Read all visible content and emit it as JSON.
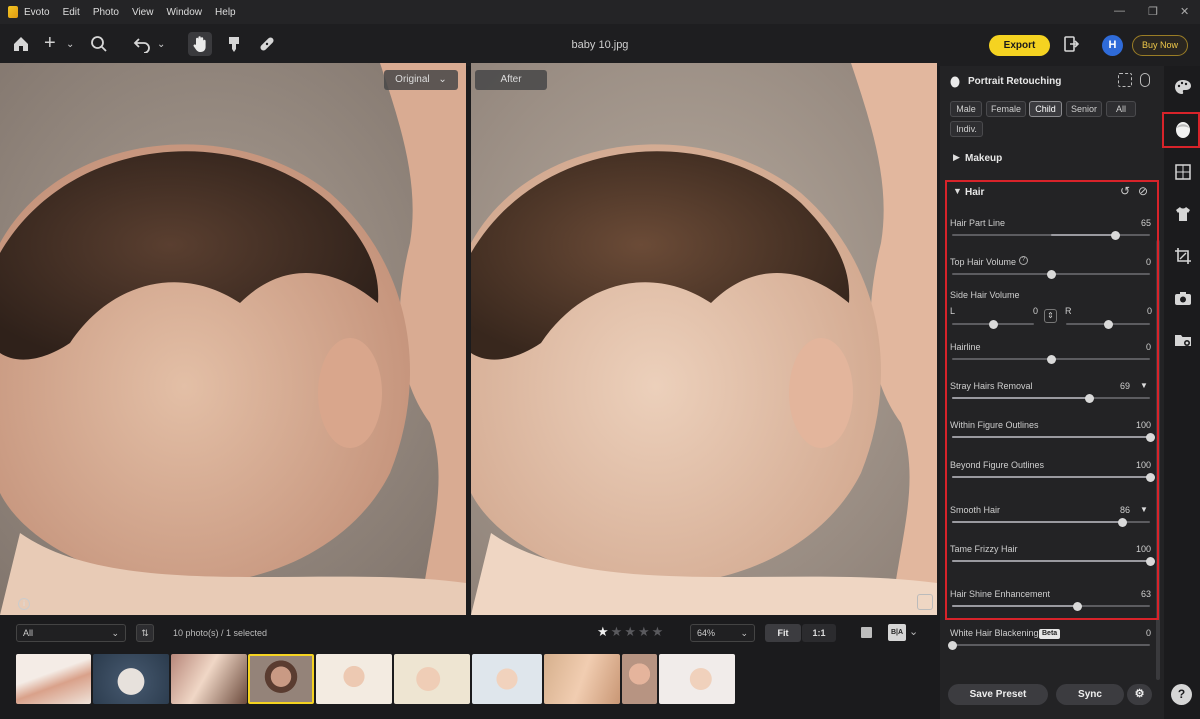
{
  "menu": {
    "app": "Evoto",
    "items": [
      "Edit",
      "Photo",
      "View",
      "Window",
      "Help"
    ]
  },
  "toolbar": {
    "file_title": "baby 10.jpg",
    "export_label": "Export",
    "avatar_letter": "H",
    "buy_label": "Buy Now"
  },
  "viewer": {
    "original_label": "Original",
    "after_label": "After",
    "info_glyph": "i"
  },
  "bottom": {
    "filter_value": "All",
    "count_text": "10 photo(s) / 1 selected",
    "zoom_value": "64%",
    "fit_label": "Fit",
    "one_label": "1:1",
    "rating_stars": 5,
    "rating_value": 1,
    "ba_label": "B|A"
  },
  "panel": {
    "title": "Portrait Retouching",
    "chips": [
      "Male",
      "Female",
      "Child",
      "Senior",
      "All",
      "Indiv."
    ],
    "selected_chip": "Child",
    "makeup_label": "Makeup",
    "hair_label": "Hair",
    "sliders": [
      {
        "label": "Hair Part Line",
        "value": "65",
        "v": 65,
        "bipolar": true
      },
      {
        "label": "Top Hair Volume",
        "value": "0",
        "v": 0,
        "bipolar": true
      },
      {
        "label": "Hairline",
        "value": "0",
        "v": 0,
        "bipolar": true
      },
      {
        "label": "Stray Hairs Removal",
        "value": "69",
        "v": 69,
        "bipolar": false
      },
      {
        "label": "Within Figure Outlines",
        "value": "100",
        "v": 100,
        "bipolar": false
      },
      {
        "label": "Beyond Figure Outlines",
        "value": "100",
        "v": 100,
        "bipolar": false
      },
      {
        "label": "Smooth Hair",
        "value": "86",
        "v": 86,
        "bipolar": false
      },
      {
        "label": "Tame Frizzy Hair",
        "value": "100",
        "v": 100,
        "bipolar": false
      },
      {
        "label": "Hair Shine Enhancement",
        "value": "63",
        "v": 63,
        "bipolar": false
      },
      {
        "label": "White Hair Blackening",
        "value": "0",
        "v": 0,
        "bipolar": false
      }
    ],
    "side_hair_label": "Side Hair Volume",
    "side_l": "L",
    "side_l_value": "0",
    "side_r": "R",
    "side_r_value": "0",
    "beta": "Beta",
    "save_preset": "Save Preset",
    "sync": "Sync"
  },
  "colors": {
    "accent": "#f5d321",
    "highlight": "#d8232a",
    "panel": "#232325"
  }
}
